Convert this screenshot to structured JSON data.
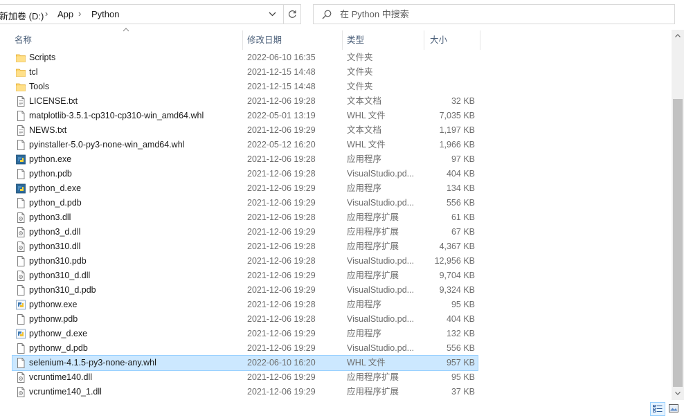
{
  "breadcrumb": [
    {
      "label": "新加卷 (D:)"
    },
    {
      "label": "App"
    },
    {
      "label": "Python"
    }
  ],
  "search": {
    "placeholder": "在 Python 中搜索"
  },
  "columns": {
    "name": "名称",
    "date": "修改日期",
    "type": "类型",
    "size": "大小"
  },
  "files": [
    {
      "name": "Scripts",
      "date": "2022-06-10 16:35",
      "type": "文件夹",
      "size": "",
      "icon": "folder-icon"
    },
    {
      "name": "tcl",
      "date": "2021-12-15 14:48",
      "type": "文件夹",
      "size": "",
      "icon": "folder-icon"
    },
    {
      "name": "Tools",
      "date": "2021-12-15 14:48",
      "type": "文件夹",
      "size": "",
      "icon": "folder-icon"
    },
    {
      "name": "LICENSE.txt",
      "date": "2021-12-06 19:28",
      "type": "文本文档",
      "size": "32 KB",
      "icon": "text-file-icon"
    },
    {
      "name": "matplotlib-3.5.1-cp310-cp310-win_amd64.whl",
      "date": "2022-05-01 13:19",
      "type": "WHL 文件",
      "size": "7,035 KB",
      "icon": "file-icon"
    },
    {
      "name": "NEWS.txt",
      "date": "2021-12-06 19:29",
      "type": "文本文档",
      "size": "1,197 KB",
      "icon": "text-file-icon"
    },
    {
      "name": "pyinstaller-5.0-py3-none-win_amd64.whl",
      "date": "2022-05-12 16:20",
      "type": "WHL 文件",
      "size": "1,966 KB",
      "icon": "file-icon"
    },
    {
      "name": "python.exe",
      "date": "2021-12-06 19:28",
      "type": "应用程序",
      "size": "97 KB",
      "icon": "python-exe-icon"
    },
    {
      "name": "python.pdb",
      "date": "2021-12-06 19:28",
      "type": "VisualStudio.pd...",
      "size": "404 KB",
      "icon": "file-icon"
    },
    {
      "name": "python_d.exe",
      "date": "2021-12-06 19:29",
      "type": "应用程序",
      "size": "134 KB",
      "icon": "python-exe-icon"
    },
    {
      "name": "python_d.pdb",
      "date": "2021-12-06 19:29",
      "type": "VisualStudio.pd...",
      "size": "556 KB",
      "icon": "file-icon"
    },
    {
      "name": "python3.dll",
      "date": "2021-12-06 19:28",
      "type": "应用程序扩展",
      "size": "61 KB",
      "icon": "dll-file-icon"
    },
    {
      "name": "python3_d.dll",
      "date": "2021-12-06 19:29",
      "type": "应用程序扩展",
      "size": "67 KB",
      "icon": "dll-file-icon"
    },
    {
      "name": "python310.dll",
      "date": "2021-12-06 19:28",
      "type": "应用程序扩展",
      "size": "4,367 KB",
      "icon": "dll-file-icon"
    },
    {
      "name": "python310.pdb",
      "date": "2021-12-06 19:28",
      "type": "VisualStudio.pd...",
      "size": "12,956 KB",
      "icon": "file-icon"
    },
    {
      "name": "python310_d.dll",
      "date": "2021-12-06 19:29",
      "type": "应用程序扩展",
      "size": "9,704 KB",
      "icon": "dll-file-icon"
    },
    {
      "name": "python310_d.pdb",
      "date": "2021-12-06 19:29",
      "type": "VisualStudio.pd...",
      "size": "9,324 KB",
      "icon": "file-icon"
    },
    {
      "name": "pythonw.exe",
      "date": "2021-12-06 19:28",
      "type": "应用程序",
      "size": "95 KB",
      "icon": "pythonw-exe-icon"
    },
    {
      "name": "pythonw.pdb",
      "date": "2021-12-06 19:28",
      "type": "VisualStudio.pd...",
      "size": "404 KB",
      "icon": "file-icon"
    },
    {
      "name": "pythonw_d.exe",
      "date": "2021-12-06 19:29",
      "type": "应用程序",
      "size": "132 KB",
      "icon": "pythonw-exe-icon"
    },
    {
      "name": "pythonw_d.pdb",
      "date": "2021-12-06 19:29",
      "type": "VisualStudio.pd...",
      "size": "556 KB",
      "icon": "file-icon"
    },
    {
      "name": "selenium-4.1.5-py3-none-any.whl",
      "date": "2022-06-10 16:20",
      "type": "WHL 文件",
      "size": "957 KB",
      "icon": "file-icon",
      "selected": true
    },
    {
      "name": "vcruntime140.dll",
      "date": "2021-12-06 19:29",
      "type": "应用程序扩展",
      "size": "95 KB",
      "icon": "dll-file-icon"
    },
    {
      "name": "vcruntime140_1.dll",
      "date": "2021-12-06 19:29",
      "type": "应用程序扩展",
      "size": "37 KB",
      "icon": "dll-file-icon"
    }
  ],
  "colors": {
    "selection_bg": "#cce8ff",
    "selection_border": "#99d1ff",
    "folder": "#ffd66b",
    "header_text": "#4c607a",
    "secondary_text": "#6d6d6d"
  },
  "icons": {
    "dropdown": "chevron-down-icon",
    "refresh": "refresh-icon",
    "search": "search-icon",
    "sort": "sort-ascending-icon",
    "details_view": "details-view-icon",
    "thumbnail_view": "large-icons-view-icon"
  }
}
